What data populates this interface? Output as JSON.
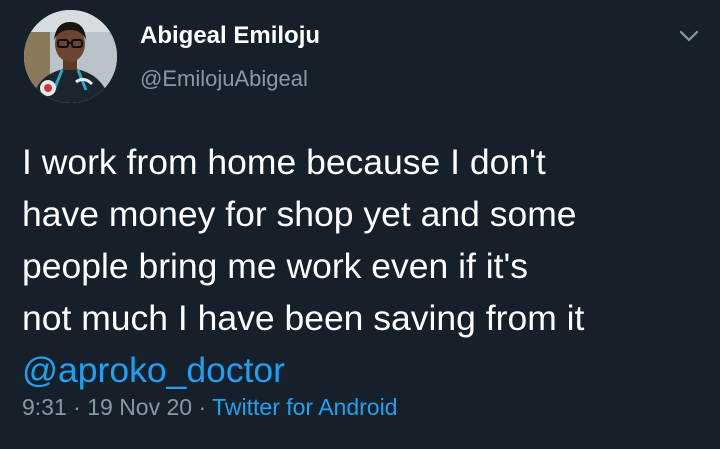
{
  "user": {
    "display_name": "Abigeal Emiloju",
    "handle": "@EmilojuAbigeal"
  },
  "tweet": {
    "lines": [
      "I work from home because I don't",
      "have money for shop yet and some",
      "people bring me work even if it's",
      "not much I have been saving from it"
    ],
    "mention": "@aproko_doctor"
  },
  "meta": {
    "time": "9:31",
    "separator": "·",
    "date": "19 Nov 20",
    "source": "Twitter for Android"
  },
  "colors": {
    "background": "#15202b",
    "text": "#ffffff",
    "secondary_text": "#8899a6",
    "accent": "#1da1f2"
  },
  "icons": {
    "menu": "chevron-down-icon"
  }
}
